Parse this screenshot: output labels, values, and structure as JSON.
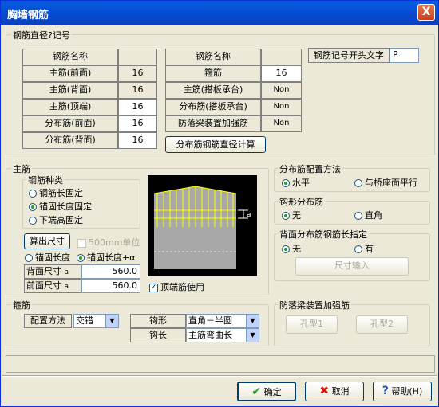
{
  "title": "胸墙钢筋",
  "close_glyph": "X",
  "diameter_group": {
    "label": "钢筋直径?记号",
    "left_table": {
      "header": "钢筋名称",
      "rows": [
        {
          "name": "主筋(前面)",
          "value": "16"
        },
        {
          "name": "主筋(背面)",
          "value": "16"
        },
        {
          "name": "主筋(顶端)",
          "value": "16"
        },
        {
          "name": "分布筋(前面)",
          "value": "16"
        },
        {
          "name": "分布筋(背面)",
          "value": "16"
        }
      ]
    },
    "right_table": {
      "header": "钢筋名称",
      "rows": [
        {
          "name": "箍筋",
          "value": "16"
        },
        {
          "name": "主筋(搭板承台)",
          "value": "Non"
        },
        {
          "name": "分布筋(搭板承台)",
          "value": "Non"
        },
        {
          "name": "防落梁装置加强筋",
          "value": "Non"
        }
      ]
    },
    "prefix_label": "钢筋记号开头文字",
    "prefix_value": "P",
    "calc_button": "分布筋钢筋直径计算"
  },
  "main_rebar": {
    "label": "主筋",
    "type_group_label": "钢筋种类",
    "types": [
      "钢筋长固定",
      "锚固长度固定",
      "下端高固定"
    ],
    "selected_type": 1,
    "calc_size_button": "算出尺寸",
    "unit_checkbox_label": "500mm单位",
    "unit_checked": false,
    "anchor_options": [
      "锚固长度",
      "锚固长度+α"
    ],
    "anchor_selected": 1,
    "back_size_label": "背面尺寸",
    "back_size_alpha": "a",
    "back_size_value": "560.0",
    "front_size_label": "前面尺寸",
    "front_size_alpha": "a",
    "front_size_value": "560.0",
    "diagram_label": "a",
    "top_rebar_label": "顶端筋使用",
    "top_rebar_checked": true
  },
  "stirrup": {
    "label": "箍筋",
    "method_label": "配置方法",
    "method_value": "交错",
    "hook_label": "钩形",
    "hook_value": "直角－半圆",
    "hook_length_label": "钩长",
    "hook_length_value": "主筋弯曲长"
  },
  "dist_method": {
    "label": "分布筋配置方法",
    "options": [
      "水平",
      "与桥座面平行"
    ],
    "selected": 0
  },
  "hook_dist": {
    "label": "钩形分布筋",
    "options": [
      "无",
      "直角"
    ],
    "selected": 0
  },
  "back_length": {
    "label": "背面分布筋钢筋长指定",
    "options": [
      "无",
      "有"
    ],
    "selected": 0,
    "input_button": "尺寸输入"
  },
  "anti_fall": {
    "label": "防落梁装置加强筋",
    "buttons": [
      "孔型1",
      "孔型2"
    ]
  },
  "footer": {
    "ok": "确定",
    "cancel": "取消",
    "help": "帮助(H)"
  },
  "colors": {
    "title_bar": "#0451d6",
    "wall_fill": "#a8a8a8",
    "rebar": "#ffff00",
    "diagram_bg": "#000000"
  }
}
